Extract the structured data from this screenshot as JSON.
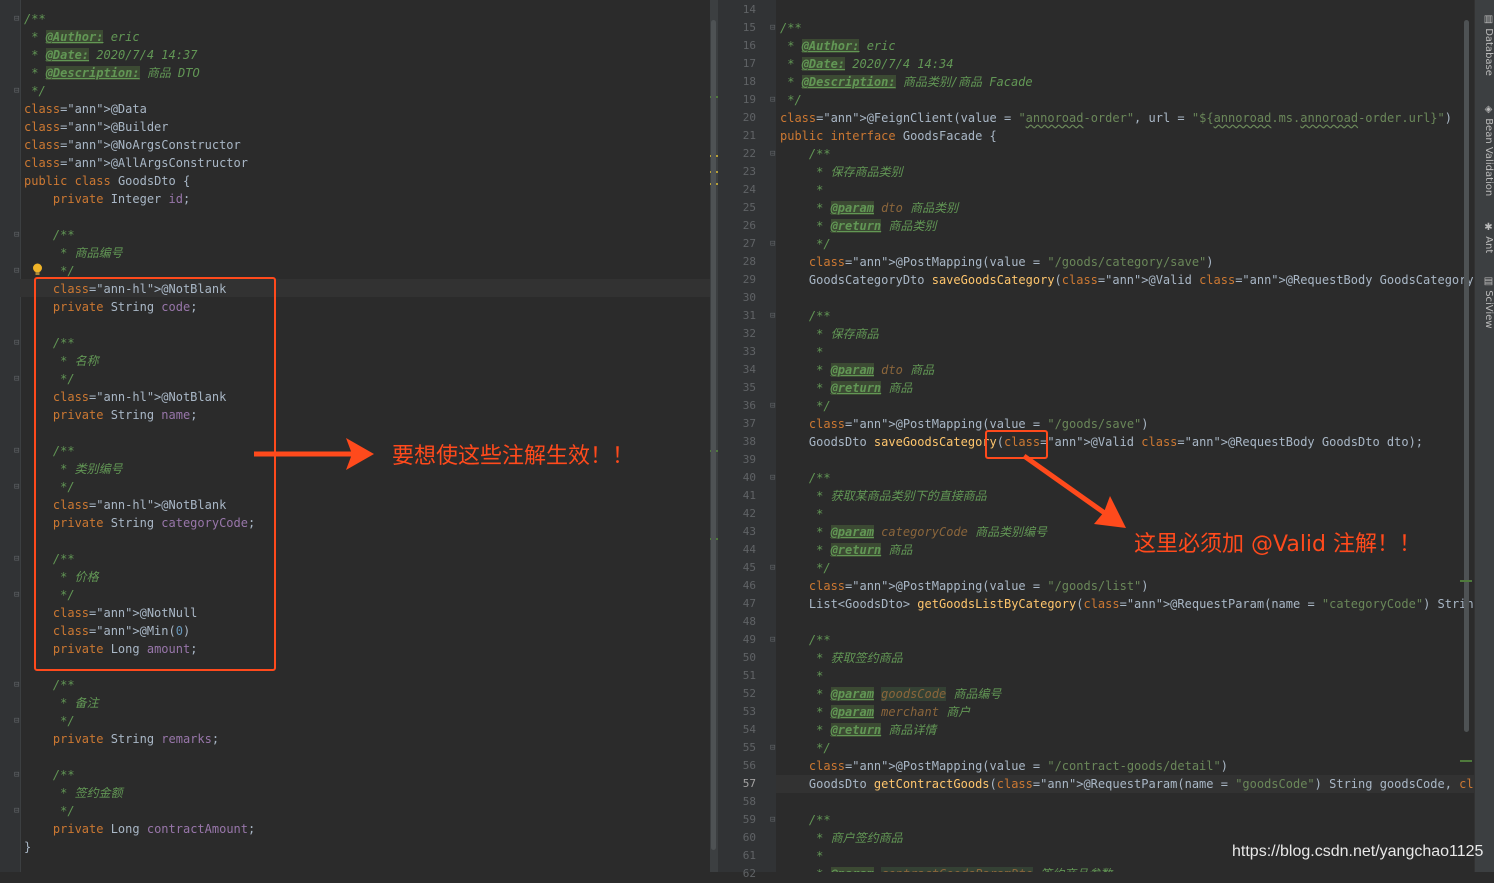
{
  "left_code": [
    "/**",
    " * @Author: eric",
    " * @Date: 2020/7/4 14:37",
    " * @Description: 商品 DTO",
    " */",
    "@Data",
    "@Builder",
    "@NoArgsConstructor",
    "@AllArgsConstructor",
    "public class GoodsDto {",
    "    private Integer id;",
    "",
    "    /**",
    "     * 商品编号",
    "     */",
    "    @NotBlank",
    "    private String code;",
    "",
    "    /**",
    "     * 名称",
    "     */",
    "    @NotBlank",
    "    private String name;",
    "",
    "    /**",
    "     * 类别编号",
    "     */",
    "    @NotBlank",
    "    private String categoryCode;",
    "",
    "    /**",
    "     * 价格",
    "     */",
    "    @NotNull",
    "    @Min(0)",
    "    private Long amount;",
    "",
    "    /**",
    "     * 备注",
    "     */",
    "    private String remarks;",
    "",
    "    /**",
    "     * 签约金额",
    "     */",
    "    private Long contractAmount;",
    "}"
  ],
  "right_line_numbers": [
    "14",
    "15",
    "16",
    "17",
    "18",
    "19",
    "20",
    "21",
    "22",
    "23",
    "24",
    "25",
    "26",
    "27",
    "28",
    "29",
    "30",
    "31",
    "32",
    "33",
    "34",
    "35",
    "36",
    "37",
    "38",
    "39",
    "40",
    "41",
    "42",
    "43",
    "44",
    "45",
    "46",
    "47",
    "48",
    "49",
    "50",
    "51",
    "52",
    "53",
    "54",
    "55",
    "56",
    "57",
    "58",
    "59",
    "60",
    "61",
    "62"
  ],
  "right_code": [
    "",
    "/**",
    " * @Author: eric",
    " * @Date: 2020/7/4 14:34",
    " * @Description: 商品类别/商品 Facade",
    " */",
    "@FeignClient(value = \"annoroad-order\", url = \"${annoroad.ms.annoroad-order.url}\")",
    "public interface GoodsFacade {",
    "    /**",
    "     * 保存商品类别",
    "     *",
    "     * @param dto 商品类别",
    "     * @return 商品类别",
    "     */",
    "    @PostMapping(value = \"/goods/category/save\")",
    "    GoodsCategoryDto saveGoodsCategory(@Valid @RequestBody GoodsCategoryDto dto);",
    "",
    "    /**",
    "     * 保存商品",
    "     *",
    "     * @param dto 商品",
    "     * @return 商品",
    "     */",
    "    @PostMapping(value = \"/goods/save\")",
    "    GoodsDto saveGoodsCategory(@Valid @RequestBody GoodsDto dto);",
    "",
    "    /**",
    "     * 获取某商品类别下的直接商品",
    "     *",
    "     * @param categoryCode 商品类别编号",
    "     * @return 商品",
    "     */",
    "    @PostMapping(value = \"/goods/list\")",
    "    List<GoodsDto> getGoodsListByCategory(@RequestParam(name = \"categoryCode\") String categoryCode);",
    "",
    "    /**",
    "     * 获取签约商品",
    "     *",
    "     * @param goodsCode 商品编号",
    "     * @param merchant 商户",
    "     * @return 商品详情",
    "     */",
    "    @PostMapping(value = \"/contract-goods/detail\")",
    "    GoodsDto getContractGoods(@RequestParam(name = \"goodsCode\") String goodsCode, @RequestParam(name",
    "",
    "    /**",
    "     * 商户签约商品",
    "     *",
    "     * @param contractGoodsParamDto 签约商品参数"
  ],
  "annotations": {
    "left_note": "要想使这些注解生效！！",
    "right_note": "这里必须加 @Valid 注解！！"
  },
  "sidebar_tabs": [
    "Database",
    "Bean Validation",
    "Ant",
    "SciView"
  ],
  "watermark": "https://blog.csdn.net/yangchao1125",
  "colors": {
    "background": "#2b2b2b",
    "keyword": "#cc7832",
    "annotation": "#bbb529",
    "string": "#6a8759",
    "comment": "#629755",
    "field": "#9876aa",
    "method": "#ffc66d",
    "highlight_red": "#ff4a1c"
  }
}
